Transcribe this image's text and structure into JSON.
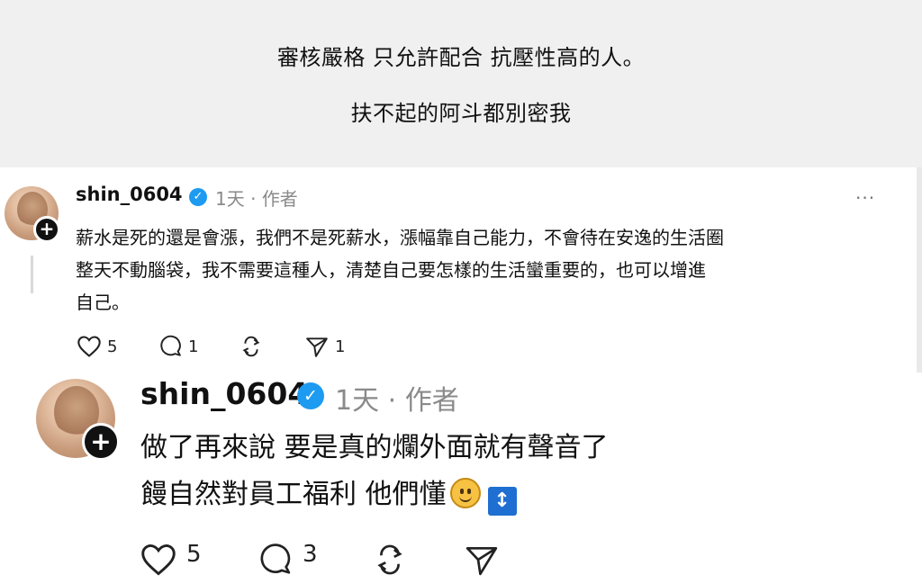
{
  "top_panel": {
    "line1": "審核嚴格 只允許配合 抗壓性高的人。",
    "line2": "扶不起的阿斗都別密我"
  },
  "post1": {
    "username": "shin_0604",
    "time": "1天",
    "separator": "·",
    "author_tag": "作者",
    "more": "···",
    "lines": [
      "薪水是死的還是會漲，我們不是死薪水，漲幅靠自己能力，不會待在安逸的生活圈",
      "整天不動腦袋，我不需要這種人，清楚自己要怎樣的生活蠻重要的，也可以增進",
      "自己。"
    ],
    "likes": "5",
    "comments": "1",
    "reposts": "",
    "shares": "1"
  },
  "post2": {
    "username": "shin_0604",
    "time": "1天",
    "separator": "·",
    "author_tag": "作者",
    "line1": "做了再來說 要是真的爛外面就有聲音了",
    "line2": "饅自然對員工福利 他們懂",
    "updown_glyph": "↕",
    "likes": "5",
    "comments": "3",
    "reposts": "",
    "shares": ""
  },
  "icons": {
    "verified": "verified-badge-icon",
    "plus": "follow-plus-icon",
    "heart": "heart-icon",
    "comment": "comment-icon",
    "repost": "repost-icon",
    "share": "send-icon",
    "smile": "smiling-face-emoji",
    "updown": "up-down-arrow-emoji"
  },
  "colors": {
    "top_panel_bg": "#f0f0f0",
    "verified": "#1d9bf0",
    "meta": "#8a8a8a",
    "updown_bg": "#1e6fd1"
  }
}
